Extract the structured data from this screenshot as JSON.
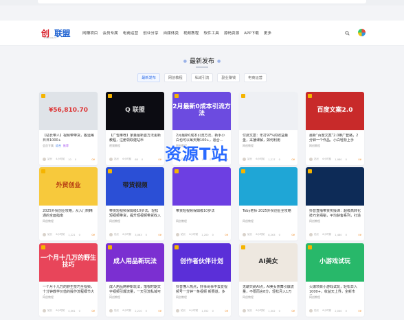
{
  "logo": {
    "text_a": "创",
    "text_b": "联盟",
    "sub": "www.aaa.cn"
  },
  "nav": {
    "items": [
      "网赚项目",
      "会员专属",
      "电商运营",
      "创业分享",
      "自媒体类",
      "视频教程",
      "软件工具",
      "源码资源",
      "APP下载",
      "更多"
    ]
  },
  "section": {
    "title": "最新发布"
  },
  "tabs": [
    "最新发布",
    "网创教程",
    "私域引流",
    "副业赚钱",
    "电商运营"
  ],
  "watermark": "资源T站",
  "colors": {
    "accent": "#2f6ee8",
    "price": "#f08a24",
    "badge": "#f5b400"
  },
  "cards": [
    {
      "title": "【站长带人】视频带带货，搬运每日日1000+",
      "tags": [
        "会员专属",
        "综合",
        "推荐"
      ],
      "meta": [
        "站长",
        "4小时前",
        "10",
        "0"
      ],
      "price": "0¥",
      "thumb": {
        "bg": "#dfe3e8",
        "text": "¥56,810.70",
        "color": "#d33"
      }
    },
    {
      "title": "【广告推荐】家量最新首方法更新教程，注册领取建站币",
      "tags": [
        "视频教程"
      ],
      "meta": [
        "站长",
        "6小时前",
        "68",
        "0"
      ],
      "price": "0¥",
      "thumb": {
        "bg": "#0c0c12",
        "text": "Q 联盟",
        "color": "#ddd"
      }
    },
    {
      "title": "2月最新0成本引流方法，新手小白也可以每天赚100+，适合...",
      "tags": [
        "网创教程"
      ],
      "meta": [
        "站长",
        "6小时前",
        "146",
        "0"
      ],
      "price": "0¥",
      "thumb": {
        "bg": "#6c4be0",
        "text": "2月最新0成本引流方法",
        "color": "#fff"
      }
    },
    {
      "title": "付费文案：年打97%的收益量金，采播课解，如何利用deepseek来...",
      "tags": [
        "网创教程"
      ],
      "meta": [
        "站长",
        "6小时前",
        "1,217",
        "0"
      ],
      "price": "0¥",
      "thumb": {
        "bg": "#eef0f4",
        "text": "",
        "color": "#333"
      }
    },
    {
      "title": "最新“百度文案”2.0推广套路，2分钟一个作品，小白轻松上手",
      "tags": [
        "网创教程"
      ],
      "meta": [
        "站长",
        "6小时前",
        "1,980",
        "0"
      ],
      "price": "0¥",
      "thumb": {
        "bg": "#c82a2a",
        "text": "百度文案2.0",
        "color": "#fff"
      }
    },
    {
      "title": "2025外贸创业攻略，从入门到精通的全面指南",
      "tags": [
        "网创教程"
      ],
      "meta": [
        "站长",
        "6小时前",
        "1,221",
        "0"
      ],
      "price": "0¥",
      "thumb": {
        "bg": "#f7c93c",
        "text": "外贸创业",
        "color": "#b53a12"
      }
    },
    {
      "title": "带货短视频保姆级10步法，轻松短视频带货，提升短视频带货收入",
      "tags": [
        "网创教程"
      ],
      "meta": [
        "站长",
        "6小时前",
        "3,063",
        "0"
      ],
      "price": "0¥",
      "thumb": {
        "bg": "#2b4fd6",
        "text": "带货视频",
        "color": "#222"
      }
    },
    {
      "title": "带货短视频保姆级10步法",
      "tags": [
        "网创教程"
      ],
      "meta": [
        "站长",
        "6小时前",
        "1,200",
        "0"
      ],
      "price": "0¥",
      "thumb": {
        "bg": "#6d3fe2",
        "text": "",
        "color": "#fff"
      }
    },
    {
      "title": "Toby老师·2025外贸创业全攻略",
      "tags": [
        "网创教程"
      ],
      "meta": [
        "站长",
        "6小时前",
        "8,263",
        "0"
      ],
      "price": "0¥",
      "thumb": {
        "bg": "#1fa6d6",
        "text": "",
        "color": "#fff"
      }
    },
    {
      "title": "抖音直播带货实操课：超级高转化技巧全揭秘，平均获客系列，打造高...",
      "tags": [
        "网创教程"
      ],
      "meta": [
        "站长",
        "6小时前",
        "1,480",
        "0"
      ],
      "price": "0¥",
      "thumb": {
        "bg": "#0d2b57",
        "text": "",
        "color": "#fff"
      }
    },
    {
      "title": "一个月十几万的野生技巧全视频，十分钟教学价值的操作流程细节大全",
      "tags": [
        "网创教程"
      ],
      "meta": [
        "站长",
        "6小时前",
        "4,061",
        "0"
      ],
      "price": "0¥",
      "thumb": {
        "bg": "#e8455a",
        "text": "一个月十几万的野生技巧",
        "color": "#fff"
      }
    },
    {
      "title": "成人用品两种新玩法，落根时期文字视频引爆流量，一天引流私域可达...",
      "tags": [
        "网创教程"
      ],
      "meta": [
        "站长",
        "6小时前",
        "2,210",
        "0"
      ],
      "price": "0¥",
      "thumb": {
        "bg": "#7b2fd1",
        "text": "成人用品新玩法",
        "color": "#fff"
      }
    },
    {
      "title": "抖音懂人热点，好事哥事中去爱视频号一分钟一条视频 新赛道，多平...",
      "tags": [
        "网创教程"
      ],
      "meta": [
        "站长",
        "6小时前",
        "1,052",
        "0"
      ],
      "price": "0¥",
      "thumb": {
        "bg": "#5b2fd8",
        "text": "创作者伙伴计划",
        "color": "#fff"
      }
    },
    {
      "title": "无聊只刷AI点，AI美女热舞引爆流量，不限而言8分，轻松月入1万",
      "tags": [
        "网创教程"
      ],
      "meta": [
        "站长",
        "6小时前",
        "1,302",
        "0"
      ],
      "price": "0¥",
      "thumb": {
        "bg": "#eee8e0",
        "text": "AI美女",
        "color": "#333"
      }
    },
    {
      "title": "火爆项目小游戏试玩，轻松日入1000+，收益天上界，全新市场！",
      "tags": [
        "网创教程"
      ],
      "meta": [
        "站长",
        "6小时前",
        "2,040",
        "0"
      ],
      "price": "0¥",
      "thumb": {
        "bg": "#28b86a",
        "text": "小游戏试玩",
        "color": "#fff"
      }
    }
  ]
}
